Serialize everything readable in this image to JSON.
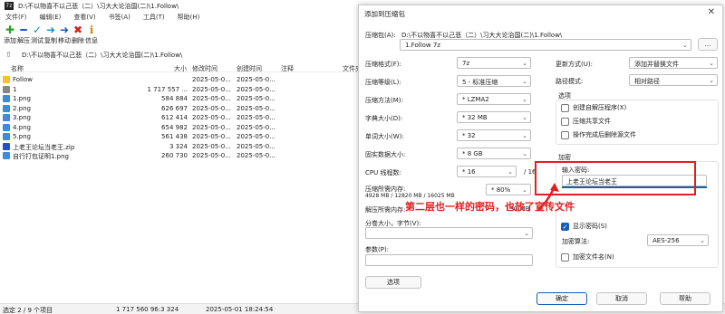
{
  "window": {
    "path": "D:\\不以物喜不以己悲（二）\\习大大论治国(二)\\1.Follow\\"
  },
  "menu": [
    "文件(F)",
    "编辑(E)",
    "查看(V)",
    "书签(A)",
    "工具(T)",
    "帮助(H)"
  ],
  "toolbar": [
    {
      "label": "添加",
      "icon": "plus-icon",
      "color": "#2aa12a",
      "glyph": "✚"
    },
    {
      "label": "解压",
      "icon": "minus-icon",
      "color": "#2451c4",
      "glyph": "━"
    },
    {
      "label": "测试",
      "icon": "check-icon",
      "color": "#1a8fd6",
      "glyph": "✓"
    },
    {
      "label": "复制",
      "icon": "copy-arrow-icon",
      "color": "#1a8fd6",
      "glyph": "➜"
    },
    {
      "label": "移动",
      "icon": "move-arrow-icon",
      "color": "#2451c4",
      "glyph": "➜"
    },
    {
      "label": "删除",
      "icon": "delete-icon",
      "color": "#d42020",
      "glyph": "✖"
    },
    {
      "label": "信息",
      "icon": "info-icon",
      "color": "#c58a00",
      "glyph": "ℹ"
    }
  ],
  "address": "D:\\不以物喜不以己悲（二）\\习大大论治国(二)\\1.Follow\\",
  "columns": {
    "name": "名称",
    "size": "大小",
    "modified": "修改时间",
    "created": "创建时间",
    "comment": "注释",
    "folder": "文件夹"
  },
  "files": [
    {
      "name": "Follow",
      "size": "",
      "modified": "2025-05-0...",
      "created": "2025-05-0...",
      "type": "folder"
    },
    {
      "name": "1",
      "size": "1 717 557 ...",
      "modified": "2025-05-0...",
      "created": "2025-05-0...",
      "type": "file"
    },
    {
      "name": "1.png",
      "size": "584 884",
      "modified": "2025-05-0...",
      "created": "2025-05-0...",
      "type": "png"
    },
    {
      "name": "2.png",
      "size": "626 697",
      "modified": "2025-05-0...",
      "created": "2025-05-0...",
      "type": "png"
    },
    {
      "name": "3.png",
      "size": "612 414",
      "modified": "2025-05-0...",
      "created": "2025-05-0...",
      "type": "png"
    },
    {
      "name": "4.png",
      "size": "654 982",
      "modified": "2025-05-0...",
      "created": "2025-05-0...",
      "type": "png"
    },
    {
      "name": "5.png",
      "size": "561 438",
      "modified": "2025-05-0...",
      "created": "2025-05-0...",
      "type": "png"
    },
    {
      "name": "上老王论坛当老王.zip",
      "size": "3 324",
      "modified": "2025-05-0...",
      "created": "2025-05-0...",
      "type": "zip"
    },
    {
      "name": "自行打包证明1.png",
      "size": "260 730",
      "modified": "2025-05-0...",
      "created": "2025-05-0...",
      "type": "png"
    }
  ],
  "status": {
    "selected": "选定 2 / 9 个项目",
    "size": "1 717 560 96:3 324",
    "date": "2025-05-01 18:24:54"
  },
  "dialog": {
    "title": "添加到压缩包",
    "close": "✕",
    "archive_label": "压缩包(A):",
    "archive_path": "D:\\不以物喜不以己悲（二）\\习大大论治国(二)\\1.Follow\\",
    "archive_name": "1.Follow 7z",
    "browse": "...",
    "format_label": "压缩格式(F):",
    "format": "7z",
    "level_label": "压缩等级(L):",
    "level": "5 - 标准压缩",
    "method_label": "压缩方法(M):",
    "method": "* LZMA2",
    "dict_label": "字典大小(D):",
    "dict": "* 32 MB",
    "word_label": "单词大小(W):",
    "word": "* 32",
    "solid_label": "固实数据大小:",
    "solid": "* 8 GB",
    "threads_label": "CPU 线程数:",
    "threads": "* 16",
    "threads_max": "/ 16",
    "mem_label": "压缩所需内存:",
    "mem_detail": "4928 MB / 12820 MB / 16025 MB",
    "mem_pct": "* 80%",
    "demem_label": "解压所需内存:",
    "demem": "130 MB",
    "split_label": "分卷大小，字节(V):",
    "params_label": "参数(P):",
    "options_btn": "选项",
    "update_label": "更新方式(U):",
    "update": "添加并替换文件",
    "pathmode_label": "路径模式:",
    "pathmode": "相对路径",
    "options_title": "选项",
    "opt_sfx": "创建自解压程序(X)",
    "opt_shared": "压缩共享文件",
    "opt_delete": "操作完成后删除源文件",
    "enc_title": "加密",
    "pwd_label": "输入密码:",
    "pwd_value": "上老王论坛当老王",
    "show_pwd": "显示密码(S)",
    "enc_method_label": "加密算法:",
    "enc_method": "AES-256",
    "enc_names": "加密文件名(N)",
    "ok": "确定",
    "cancel": "取消",
    "help": "帮助"
  },
  "annotation": {
    "note": "第二层也一样的密码，也放了宣传文件",
    "color": "#e02020"
  }
}
